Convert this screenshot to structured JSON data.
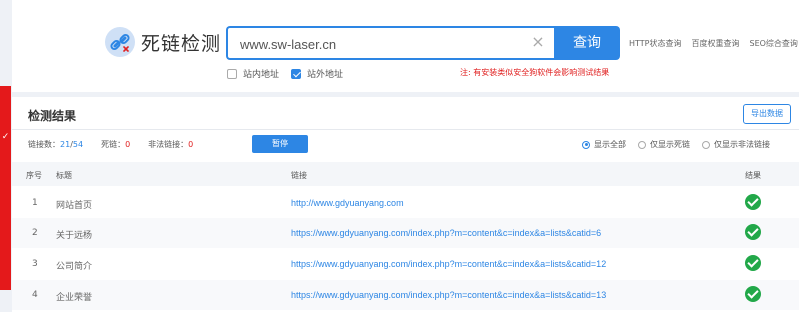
{
  "header": {
    "title": "死链检测",
    "search_value": "www.sw-laser.cn",
    "search_button": "查询",
    "quick_links": [
      "HTTP状态查询",
      "百度权重查询",
      "SEO综合查询"
    ],
    "options": [
      {
        "label": "站内地址",
        "checked": false
      },
      {
        "label": "站外地址",
        "checked": true
      }
    ],
    "warning": "注: 有安装类似安全狗软件会影响测试结果"
  },
  "results": {
    "title": "检测结果",
    "export_label": "导出数据",
    "stats": {
      "links_label": "链接数：",
      "links_done": "21",
      "links_total": "54",
      "dead_label": "死链：",
      "dead_count": "0",
      "illegal_label": "非法链接：",
      "illegal_count": "0"
    },
    "pause_label": "暂停",
    "filters": [
      {
        "label": "显示全部",
        "selected": true
      },
      {
        "label": "仅显示死链",
        "selected": false
      },
      {
        "label": "仅显示非法链接",
        "selected": false
      }
    ],
    "columns": [
      "序号",
      "标题",
      "链接",
      "结果"
    ],
    "rows": [
      {
        "no": "1",
        "title": "网站首页",
        "url": "http://www.gdyuanyang.com",
        "ok": true
      },
      {
        "no": "2",
        "title": "关于远杨",
        "url": "https://www.gdyuanyang.com/index.php?m=content&c=index&a=lists&catid=6",
        "ok": true
      },
      {
        "no": "3",
        "title": "公司简介",
        "url": "https://www.gdyuanyang.com/index.php?m=content&c=index&a=lists&catid=12",
        "ok": true
      },
      {
        "no": "4",
        "title": "企业荣誉",
        "url": "https://www.gdyuanyang.com/index.php?m=content&c=index&a=lists&catid=13",
        "ok": true
      }
    ]
  },
  "colors": {
    "accent": "#2d86e4",
    "warning": "#e02020",
    "success": "#22a849",
    "side_tab": "#e4191b"
  }
}
